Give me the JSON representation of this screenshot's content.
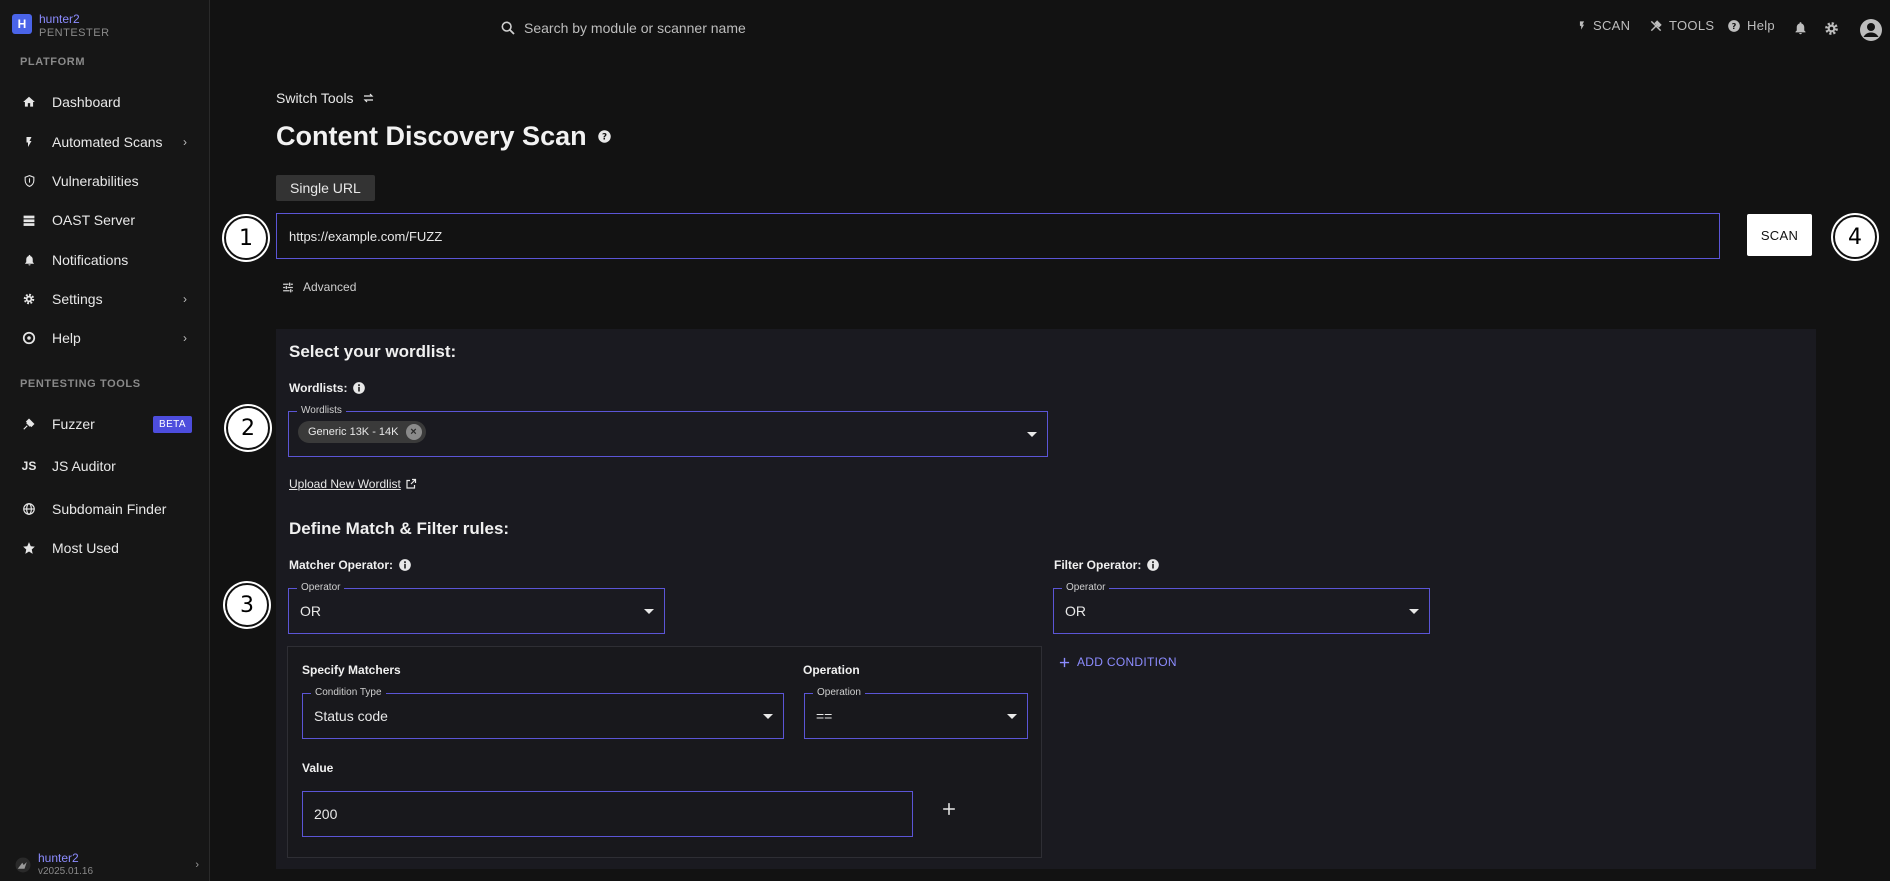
{
  "brand": {
    "logo_letter": "H",
    "name": "hunter2",
    "role": "PENTESTER"
  },
  "sidebar": {
    "platform_label": "PLATFORM",
    "platform_items": [
      {
        "label": "Dashboard",
        "icon": "home-icon"
      },
      {
        "label": "Automated Scans",
        "icon": "bolt-icon",
        "has_chevron": true
      },
      {
        "label": "Vulnerabilities",
        "icon": "shield-icon"
      },
      {
        "label": "OAST Server",
        "icon": "server-icon"
      },
      {
        "label": "Notifications",
        "icon": "bell-icon"
      },
      {
        "label": "Settings",
        "icon": "gear-icon",
        "has_chevron": true
      },
      {
        "label": "Help",
        "icon": "lifebuoy-icon",
        "has_chevron": true
      }
    ],
    "tools_label": "PENTESTING TOOLS",
    "tools_items": [
      {
        "label": "Fuzzer",
        "icon": "fuzzer-icon",
        "badge": "BETA"
      },
      {
        "label": "JS Auditor",
        "icon": "js-icon"
      },
      {
        "label": "Subdomain Finder",
        "icon": "globe-icon"
      },
      {
        "label": "Most Used",
        "icon": "star-icon"
      }
    ],
    "footer": {
      "user": "hunter2",
      "version": "v2025.01.16"
    }
  },
  "topbar": {
    "search_placeholder": "Search by module or scanner name",
    "scan_label": "SCAN",
    "tools_label": "TOOLS",
    "help_label": "Help"
  },
  "main": {
    "switch_tools": "Switch Tools",
    "title": "Content Discovery Scan",
    "tab_single_url": "Single URL",
    "url_value": "https://example.com/FUZZ",
    "scan_button": "SCAN",
    "advanced": "Advanced",
    "markers": [
      "1",
      "2",
      "3",
      "4"
    ],
    "wordlist": {
      "heading": "Select your wordlist:",
      "label": "Wordlists:",
      "field_legend": "Wordlists",
      "chip": "Generic 13K - 14K",
      "upload_link": "Upload New Wordlist"
    },
    "rules": {
      "heading": "Define Match & Filter rules:",
      "matcher_operator_label": "Matcher Operator:",
      "filter_operator_label": "Filter Operator:",
      "operator_legend": "Operator",
      "matcher_operator_value": "OR",
      "filter_operator_value": "OR",
      "add_condition": "ADD CONDITION",
      "specify_matchers": "Specify Matchers",
      "operation_heading": "Operation",
      "condition_type_legend": "Condition Type",
      "condition_type_value": "Status code",
      "operation_legend": "Operation",
      "operation_value": "==",
      "value_label": "Value",
      "value": "200"
    }
  },
  "colors": {
    "accent": "#5b55d6",
    "link": "#8c8cff",
    "background": "#121212",
    "panel": "#1a1a20"
  }
}
